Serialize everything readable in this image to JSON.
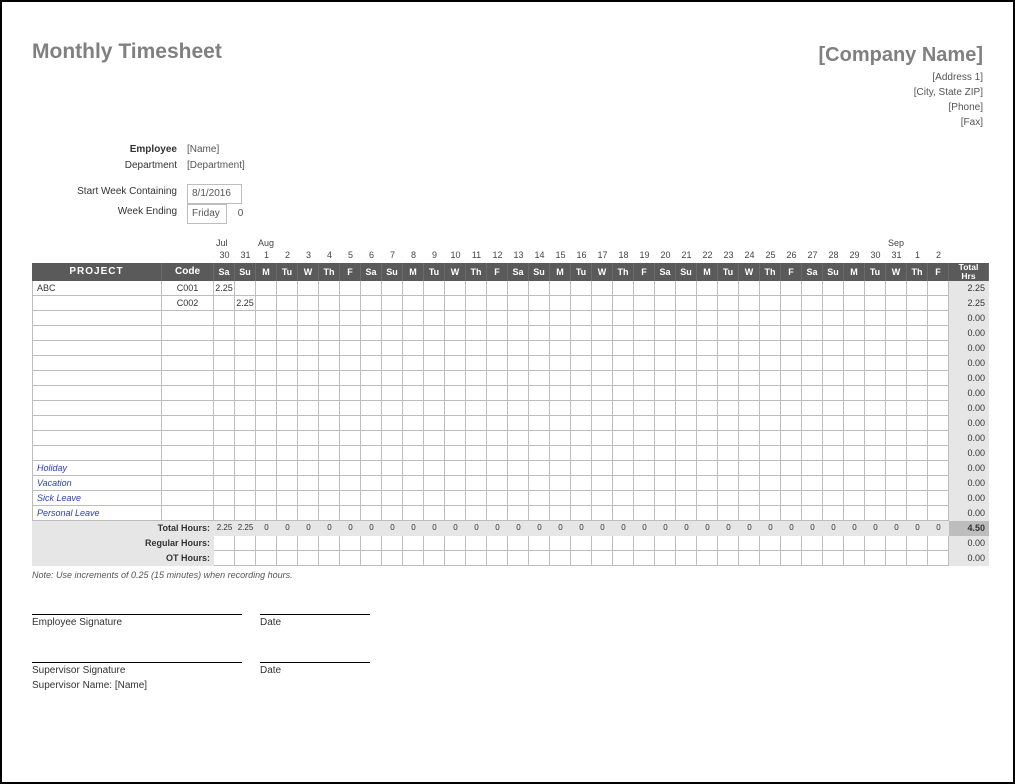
{
  "title": "Monthly Timesheet",
  "company": {
    "name": "[Company Name]",
    "address": "[Address 1]",
    "city": "[City, State ZIP]",
    "phone": "[Phone]",
    "fax": "[Fax]"
  },
  "meta": {
    "employee_label": "Employee",
    "employee_value": "[Name]",
    "dept_label": "Department",
    "dept_value": "[Department]",
    "startweek_label": "Start Week Containing",
    "startweek_value": "8/1/2016",
    "weekending_label": "Week Ending",
    "weekending_value": "Friday",
    "weekending_num": "0"
  },
  "months": {
    "jul": "Jul",
    "aug": "Aug",
    "sep": "Sep"
  },
  "days": [
    "30",
    "31",
    "1",
    "2",
    "3",
    "4",
    "5",
    "6",
    "7",
    "8",
    "9",
    "10",
    "11",
    "12",
    "13",
    "14",
    "15",
    "16",
    "17",
    "18",
    "19",
    "20",
    "21",
    "22",
    "23",
    "24",
    "25",
    "26",
    "27",
    "28",
    "29",
    "30",
    "31",
    "1",
    "2"
  ],
  "dows": [
    "Sa",
    "Su",
    "M",
    "Tu",
    "W",
    "Th",
    "F",
    "Sa",
    "Su",
    "M",
    "Tu",
    "W",
    "Th",
    "F",
    "Sa",
    "Su",
    "M",
    "Tu",
    "W",
    "Th",
    "F",
    "Sa",
    "Su",
    "M",
    "Tu",
    "W",
    "Th",
    "F",
    "Sa",
    "Su",
    "M",
    "Tu",
    "W",
    "Th",
    "F"
  ],
  "headers": {
    "project": "PROJECT",
    "code": "Code",
    "total_hrs_l1": "Total",
    "total_hrs_l2": "Hrs"
  },
  "rows": [
    {
      "project": "ABC",
      "code": "C001",
      "hours": [
        "2.25",
        "",
        "",
        "",
        "",
        "",
        "",
        "",
        "",
        "",
        "",
        "",
        "",
        "",
        "",
        "",
        "",
        "",
        "",
        "",
        "",
        "",
        "",
        "",
        "",
        "",
        "",
        "",
        "",
        "",
        "",
        "",
        "",
        "",
        ""
      ],
      "total": "2.25"
    },
    {
      "project": "",
      "code": "C002",
      "hours": [
        "",
        "2.25",
        "",
        "",
        "",
        "",
        "",
        "",
        "",
        "",
        "",
        "",
        "",
        "",
        "",
        "",
        "",
        "",
        "",
        "",
        "",
        "",
        "",
        "",
        "",
        "",
        "",
        "",
        "",
        "",
        "",
        "",
        "",
        "",
        ""
      ],
      "total": "2.25"
    },
    {
      "project": "",
      "code": "",
      "hours": [],
      "total": "0.00"
    },
    {
      "project": "",
      "code": "",
      "hours": [],
      "total": "0.00"
    },
    {
      "project": "",
      "code": "",
      "hours": [],
      "total": "0.00"
    },
    {
      "project": "",
      "code": "",
      "hours": [],
      "total": "0.00"
    },
    {
      "project": "",
      "code": "",
      "hours": [],
      "total": "0.00"
    },
    {
      "project": "",
      "code": "",
      "hours": [],
      "total": "0.00"
    },
    {
      "project": "",
      "code": "",
      "hours": [],
      "total": "0.00"
    },
    {
      "project": "",
      "code": "",
      "hours": [],
      "total": "0.00"
    },
    {
      "project": "",
      "code": "",
      "hours": [],
      "total": "0.00"
    },
    {
      "project": "",
      "code": "",
      "hours": [],
      "total": "0.00"
    }
  ],
  "leave_rows": [
    {
      "name": "Holiday",
      "total": "0.00"
    },
    {
      "name": "Vacation",
      "total": "0.00"
    },
    {
      "name": "Sick Leave",
      "total": "0.00"
    },
    {
      "name": "Personal Leave",
      "total": "0.00"
    }
  ],
  "totals": {
    "total_hours_label": "Total Hours:",
    "total_hours": [
      "2.25",
      "2.25",
      "0",
      "0",
      "0",
      "0",
      "0",
      "0",
      "0",
      "0",
      "0",
      "0",
      "0",
      "0",
      "0",
      "0",
      "0",
      "0",
      "0",
      "0",
      "0",
      "0",
      "0",
      "0",
      "0",
      "0",
      "0",
      "0",
      "0",
      "0",
      "0",
      "0",
      "0",
      "0",
      "0"
    ],
    "grand_total": "4.50",
    "regular_label": "Regular Hours:",
    "regular_total": "0.00",
    "ot_label": "OT Hours:",
    "ot_total": "0.00"
  },
  "note": "Note: Use increments of 0.25 (15 minutes) when recording hours.",
  "sig": {
    "emp": "Employee Signature",
    "date": "Date",
    "sup": "Supervisor Signature",
    "supname_label": "Supervisor Name:",
    "supname_value": "[Name]"
  }
}
